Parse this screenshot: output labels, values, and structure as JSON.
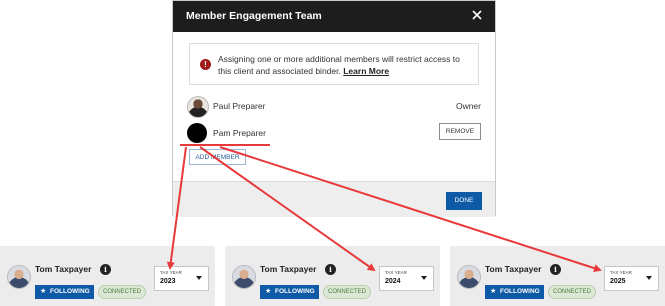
{
  "modal": {
    "title": "Member Engagement Team",
    "alert_text": "Assigning one or more additional members will restrict access to this client and associated binder.",
    "learn_more": "Learn More",
    "alert_icon": "!",
    "members": [
      {
        "name": "Paul Preparer",
        "role": "Owner"
      },
      {
        "name": "Pam Preparer",
        "action": "REMOVE"
      }
    ],
    "add_member": "ADD MEMBER",
    "done": "DONE"
  },
  "cards": [
    {
      "name": "Tom Taxpayer",
      "follow": "FOLLOWING",
      "status": "CONNECTED",
      "tax_year_label": "TAX YEAR",
      "tax_year": "2023"
    },
    {
      "name": "Tom Taxpayer",
      "follow": "FOLLOWING",
      "status": "CONNECTED",
      "tax_year_label": "TAX YEAR",
      "tax_year": "2024"
    },
    {
      "name": "Tom Taxpayer",
      "follow": "FOLLOWING",
      "status": "CONNECTED",
      "tax_year_label": "TAX YEAR",
      "tax_year": "2025"
    }
  ],
  "colors": {
    "header_bg": "#1d1d1d",
    "primary_blue": "#0e5aa7",
    "alert_red": "#a01a1a",
    "annotation_red": "#e8393b",
    "connected_green": "#4d7d3b"
  },
  "icons": [
    "close-icon",
    "alert-icon",
    "info-icon",
    "star-icon",
    "chevron-down-icon"
  ]
}
